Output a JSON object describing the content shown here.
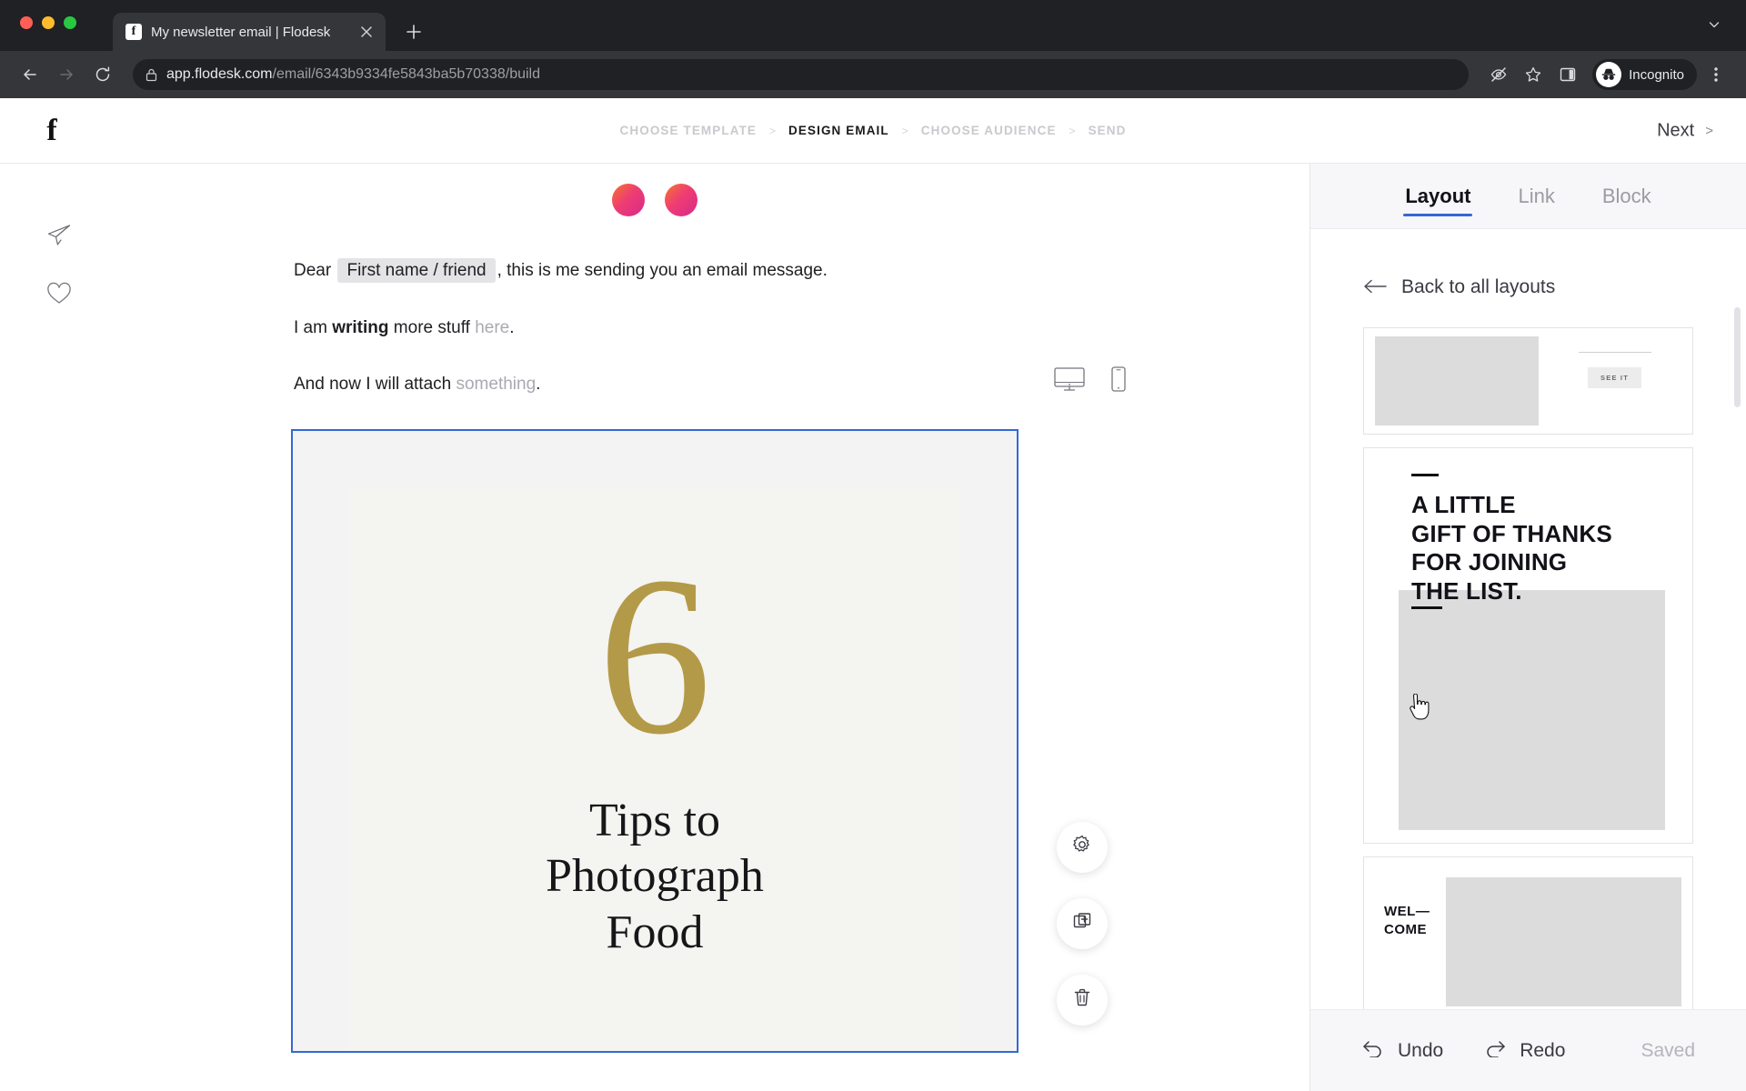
{
  "browser": {
    "tab": {
      "title": "My newsletter email | Flodesk",
      "favicon_icon": "flodesk-f-icon",
      "close_icon": "close-icon"
    },
    "new_tab_icon": "plus-icon",
    "tab_list_icon": "chevron-down-icon",
    "back_icon": "back-arrow-icon",
    "forward_icon": "forward-arrow-icon",
    "reload_icon": "reload-icon",
    "lock_icon": "lock-icon",
    "url_host": "app.flodesk.com",
    "url_path": "/email/6343b9334fe5843ba5b70338/build",
    "url_full": "app.flodesk.com/email/6343b9334fe5843ba5b70338/build",
    "third_party_cookie_icon": "eye-slash-icon",
    "bookmark_icon": "star-icon",
    "side_panel_icon": "side-panel-icon",
    "profile_icon": "incognito-icon",
    "profile_label": "Incognito",
    "menu_icon": "three-dot-menu-icon"
  },
  "app": {
    "brand_logo": "f",
    "steps": [
      {
        "label": "Choose template",
        "active": false
      },
      {
        "label": "Design email",
        "active": true
      },
      {
        "label": "Choose audience",
        "active": false
      },
      {
        "label": "Send",
        "active": false
      }
    ],
    "step_separator": ">",
    "next_label": "Next",
    "next_chevron": ">"
  },
  "canvas": {
    "rail": [
      {
        "icon": "paper-plane-icon",
        "name": "send-test-icon"
      },
      {
        "icon": "heart-icon",
        "name": "favorite-icon"
      }
    ],
    "device_toggle": [
      {
        "icon": "desktop-icon",
        "name": "desktop-preview-toggle",
        "active": true
      },
      {
        "icon": "mobile-icon",
        "name": "mobile-preview-toggle",
        "active": false
      }
    ],
    "email": {
      "paragraph1": {
        "prefix": "Dear",
        "merge_tag": "First name / friend",
        "suffix": ", this is me sending you an email message."
      },
      "paragraph2": {
        "before": "I am ",
        "bold": "writing",
        "middle": " more stuff ",
        "link": "here",
        "after": "."
      },
      "paragraph3": {
        "before": "And now I will attach ",
        "link": "something",
        "after": "."
      },
      "image_block": {
        "numeral": "6",
        "title": "Tips to\nPhotograph\nFood",
        "selected": true,
        "selection_color": "#3568d4"
      }
    },
    "block_actions": [
      {
        "icon": "gear-icon",
        "name": "block-settings-button"
      },
      {
        "icon": "duplicate-icon",
        "name": "block-duplicate-button"
      },
      {
        "icon": "trash-icon",
        "name": "block-delete-button"
      }
    ]
  },
  "panel": {
    "tabs": [
      {
        "label": "Layout",
        "active": true
      },
      {
        "label": "Link",
        "active": false
      },
      {
        "label": "Block",
        "active": false
      }
    ],
    "back_label": "Back to all layouts",
    "back_icon": "left-arrow-icon",
    "layout_cards": [
      {
        "type": "image-left-button-right",
        "button_label": "SEE IT"
      },
      {
        "type": "headline-over-image",
        "headline": "A LITTLE\nGIFT OF THANKS\nFOR JOINING\nTHE LIST."
      },
      {
        "type": "label-left-image-right",
        "headline": "WEL—\nCOME"
      }
    ],
    "footer": {
      "undo_label": "Undo",
      "undo_icon": "undo-icon",
      "redo_label": "Redo",
      "redo_icon": "redo-icon",
      "status": "Saved"
    }
  }
}
